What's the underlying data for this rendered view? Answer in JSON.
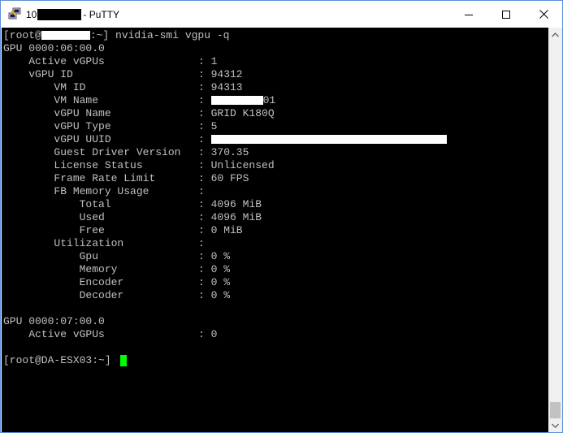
{
  "window": {
    "title_prefix": "10",
    "title_suffix": "- PuTTY",
    "app_icon": "putty-icon"
  },
  "terminal": {
    "prompt1_start": "[root@",
    "prompt1_cmd": ":~] nvidia-smi vgpu -q",
    "gpu1": "GPU 0000:06:00.0",
    "active_vgpus_label": "Active vGPUs",
    "active_vgpus_value": ": 1",
    "vgpu_id_label": "vGPU ID",
    "vgpu_id_value": ": 94312",
    "vm_id_label": "VM ID",
    "vm_id_value": ": 94313",
    "vm_name_label": "VM Name",
    "vm_name_colon": ":",
    "vm_name_suffix": "01",
    "vgpu_name_label": "vGPU Name",
    "vgpu_name_value": ": GRID K180Q",
    "vgpu_type_label": "vGPU Type",
    "vgpu_type_value": ": 5",
    "vgpu_uuid_label": "vGPU UUID",
    "vgpu_uuid_colon": ":",
    "guest_driver_label": "Guest Driver Version",
    "guest_driver_value": ": 370.35",
    "license_label": "License Status",
    "license_value": ": Unlicensed",
    "frame_rate_label": "Frame Rate Limit",
    "frame_rate_value": ": 60 FPS",
    "fb_memory_label": "FB Memory Usage",
    "fb_memory_value": ":",
    "total_label": "Total",
    "total_value": ": 4096 MiB",
    "used_label": "Used",
    "used_value": ": 4096 MiB",
    "free_label": "Free",
    "free_value": ": 0 MiB",
    "utilization_label": "Utilization",
    "utilization_value": ":",
    "gpu_util_label": "Gpu",
    "gpu_util_value": ": 0 %",
    "memory_util_label": "Memory",
    "memory_util_value": ": 0 %",
    "encoder_label": "Encoder",
    "encoder_value": ": 0 %",
    "decoder_label": "Decoder",
    "decoder_value": ": 0 %",
    "gpu2": "GPU 0000:07:00.0",
    "active_vgpus2_label": "Active vGPUs",
    "active_vgpus2_value": ": 0",
    "prompt2": "[root@DA-ESX03:~]",
    "cursor_color": "#00ff00",
    "text_color": "#c0c0c0",
    "background": "#000000"
  }
}
